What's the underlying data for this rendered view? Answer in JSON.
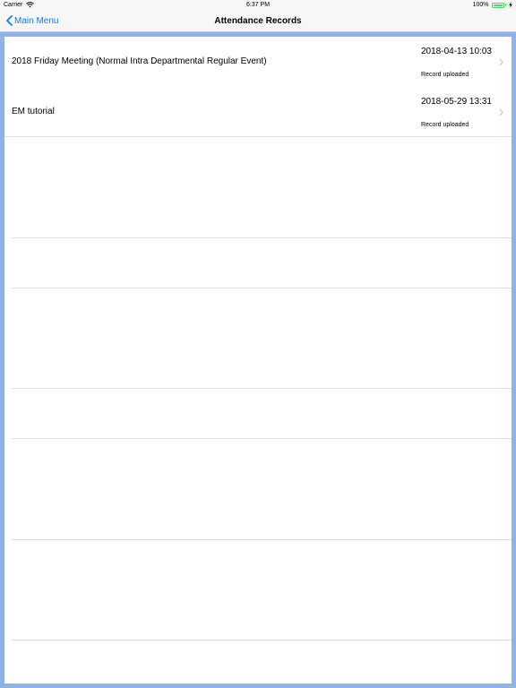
{
  "status_bar": {
    "carrier": "Carrier",
    "time": "6:37 PM",
    "battery": "100%"
  },
  "nav": {
    "back_label": "Main Menu",
    "title": "Attendance Records"
  },
  "records": [
    {
      "title": "2018 Friday Meeting (Normal Intra Departmental Regular Event)",
      "datetime": "2018-04-13 10:03",
      "status": "Record uploaded"
    },
    {
      "title": "EM tutorial",
      "datetime": "2018-05-29 13:31",
      "status": "Record uploaded"
    }
  ],
  "colors": {
    "accent": "#0a7aff",
    "frame": "#8fb3e6",
    "battery": "#4cd964"
  }
}
